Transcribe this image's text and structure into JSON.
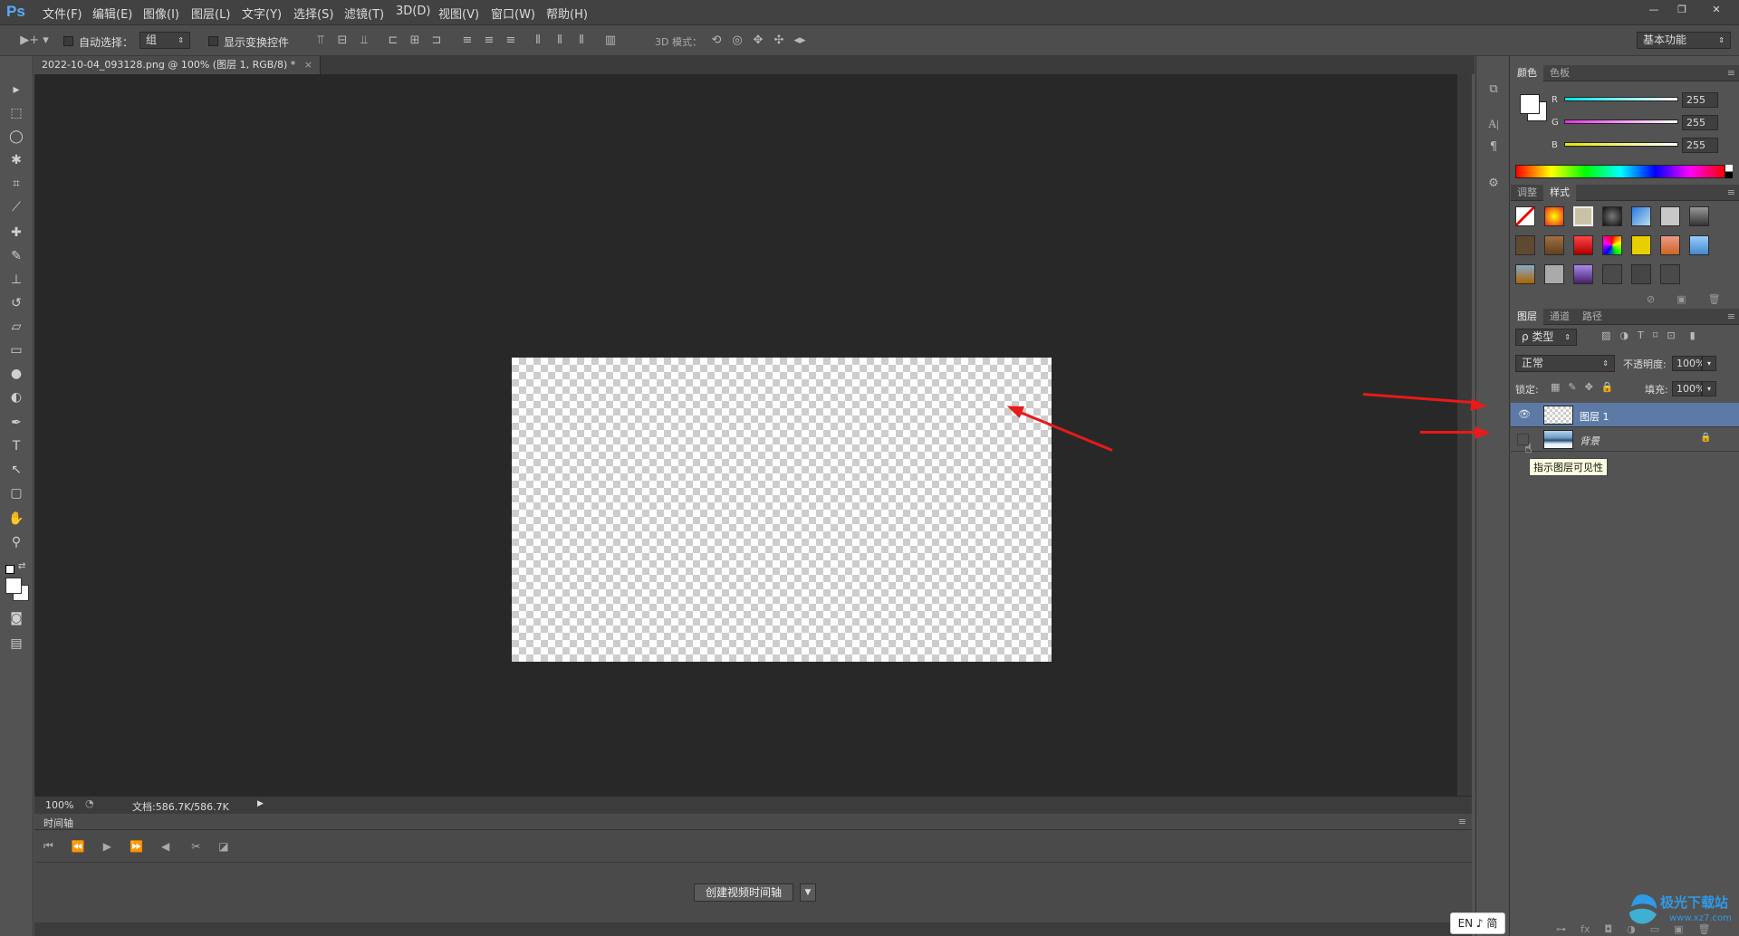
{
  "app": {
    "logo": "Ps"
  },
  "menu": [
    "文件(F)",
    "编辑(E)",
    "图像(I)",
    "图层(L)",
    "文字(Y)",
    "选择(S)",
    "滤镜(T)",
    "3D(D)",
    "视图(V)",
    "窗口(W)",
    "帮助(H)"
  ],
  "window_controls": [
    "—",
    "❐",
    "✕"
  ],
  "options": {
    "auto_select_label": "自动选择：",
    "auto_select_value": "组",
    "show_transform_label": "显示变换控件",
    "mode3d_label": "3D 模式：",
    "workspace": "基本功能"
  },
  "document": {
    "tab_title": "2022-10-04_093128.png @ 100% (图层 1, RGB/8) *",
    "close": "×",
    "zoom": "100%",
    "doc_size": "文档:586.7K/586.7K"
  },
  "timeline": {
    "title": "时间轴",
    "create_button": "创建视频时间轴"
  },
  "color_panel": {
    "tabs": [
      "颜色",
      "色板"
    ],
    "channels": [
      {
        "label": "R",
        "value": "255",
        "color": "#00e5e5"
      },
      {
        "label": "G",
        "value": "255",
        "color": "#e530e5"
      },
      {
        "label": "B",
        "value": "255",
        "color": "#e5e500"
      }
    ]
  },
  "styles_panel": {
    "tabs": [
      "调整",
      "样式"
    ]
  },
  "layers_panel": {
    "tabs": [
      "图层",
      "通道",
      "路径"
    ],
    "filter_kind": "ρ 类型",
    "blend_mode": "正常",
    "opacity_label": "不透明度:",
    "opacity_value": "100%",
    "lock_label": "锁定:",
    "fill_label": "填充:",
    "fill_value": "100%",
    "layers": [
      {
        "name": "图层 1",
        "visible": true,
        "selected": true
      },
      {
        "name": "背景",
        "visible": false,
        "selected": false,
        "locked": true
      }
    ],
    "tooltip": "指示图层可见性"
  },
  "accent_colors": {
    "annotation_arrow": "#e81a1a",
    "selected_layer": "#5d7aa6"
  },
  "ime": "EN ♪ 简",
  "watermark": {
    "cn": "极光下载站",
    "url": "www.xz7.com"
  }
}
